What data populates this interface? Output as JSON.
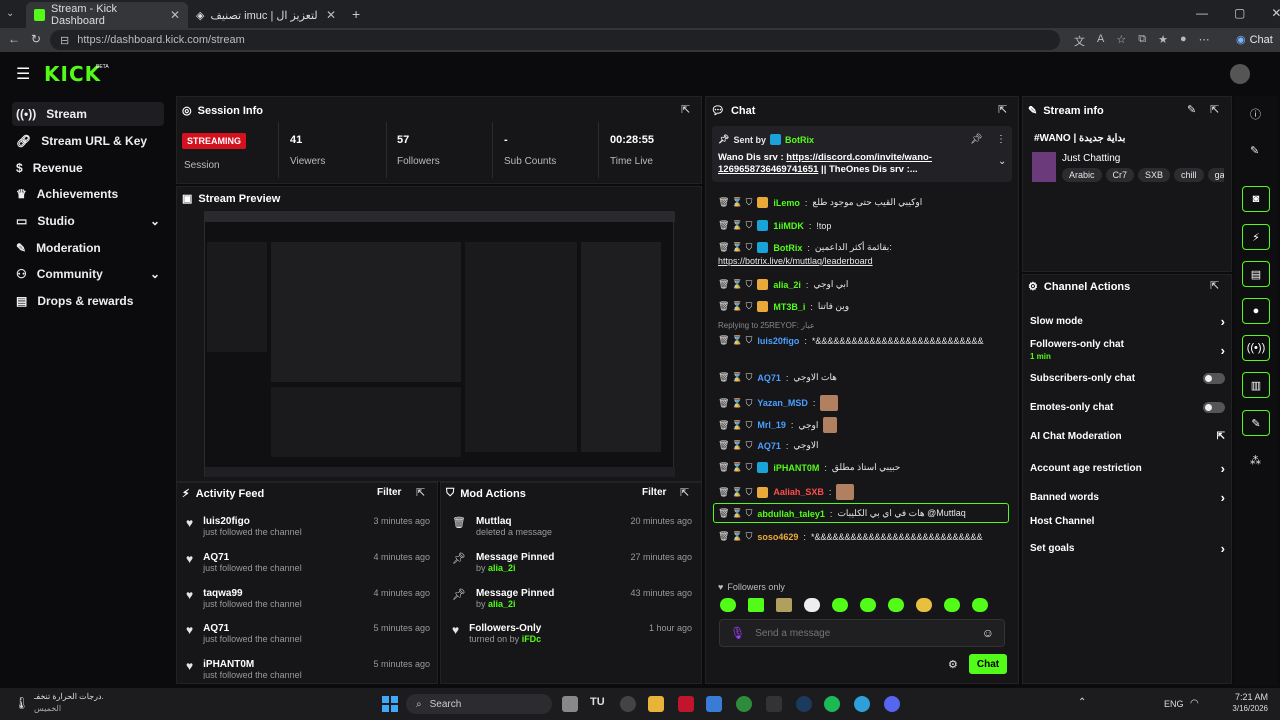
{
  "browser": {
    "tabs": [
      {
        "label": "Stream - Kick Dashboard"
      },
      {
        "label": "تصنيف imuc | أفضل برنامج لتعزيز ال..."
      }
    ],
    "url": "https://dashboard.kick.com/stream",
    "chat_label": "Chat"
  },
  "brand": {
    "logo": "KICK",
    "beta": "BETA"
  },
  "sidebar": {
    "items": [
      {
        "label": "Stream"
      },
      {
        "label": "Stream URL & Key"
      },
      {
        "label": "Revenue"
      },
      {
        "label": "Achievements"
      },
      {
        "label": "Studio"
      },
      {
        "label": "Moderation"
      },
      {
        "label": "Community"
      },
      {
        "label": "Drops & rewards"
      }
    ]
  },
  "session": {
    "title": "Session Info",
    "status": "STREAMING",
    "session_label": "Session",
    "stats": [
      {
        "value": "41",
        "label": "Viewers"
      },
      {
        "value": "57",
        "label": "Followers"
      },
      {
        "value": "-",
        "label": "Sub Counts"
      },
      {
        "value": "00:28:55",
        "label": "Time Live"
      }
    ]
  },
  "preview": {
    "title": "Stream Preview"
  },
  "activity": {
    "title": "Activity Feed",
    "filter": "Filter",
    "items": [
      {
        "name": "luis20figo",
        "desc": "just followed the channel",
        "time": "3 minutes ago"
      },
      {
        "name": "AQ71",
        "desc": "just followed the channel",
        "time": "4 minutes ago"
      },
      {
        "name": "taqwa99",
        "desc": "just followed the channel",
        "time": "4 minutes ago"
      },
      {
        "name": "AQ71",
        "desc": "just followed the channel",
        "time": "5 minutes ago"
      },
      {
        "name": "iPHANT0M",
        "desc": "just followed the channel",
        "time": "5 minutes ago"
      }
    ]
  },
  "modactions": {
    "title": "Mod Actions",
    "filter": "Filter",
    "items": [
      {
        "name": "Muttlaq",
        "desc": "deleted a message",
        "by": "",
        "time": "20 minutes ago"
      },
      {
        "name": "Message Pinned",
        "desc": "by",
        "by": "alia_2i",
        "time": "27 minutes ago"
      },
      {
        "name": "Message Pinned",
        "desc": "by",
        "by": "alia_2i",
        "time": "43 minutes ago"
      },
      {
        "name": "Followers-Only",
        "desc": "turned on by",
        "by": "iFDc",
        "time": "1 hour ago"
      }
    ]
  },
  "chat": {
    "title": "Chat",
    "pinned": {
      "sent_by": "Sent by",
      "user": "BotRix",
      "text_prefix": "Wano Dis srv : ",
      "link": "https://discord.com/invite/wano-1269658736469741651",
      "text_suffix": " || TheOnes Dis srv :..."
    },
    "messages": [
      {
        "user": "iLemo",
        "color": "#53fc18",
        "text": "اوكيبي القيب حتى موجود طلع"
      },
      {
        "user": "1iiMDK",
        "color": "#53fc18",
        "text": "!top"
      },
      {
        "user": "BotRix",
        "color": "#53fc18",
        "text": "بقائمة أكثر الداعمين:"
      },
      {
        "user": "alia_2i",
        "color": "#53fc18",
        "text": "ابي اوجي"
      },
      {
        "user": "MT3B_i",
        "color": "#53fc18",
        "text": "وين فاتنا"
      },
      {
        "user": "luis20figo",
        "color": "#4a9fff",
        "text": "*&&&&&&&&&&&&&&&&&&&&&&&&&&&&"
      },
      {
        "user": "AQ71",
        "color": "#4a9fff",
        "text": "هات الاوجي"
      },
      {
        "user": "Yazan_MSD",
        "color": "#4a9fff",
        "text": ""
      },
      {
        "user": "Mrl_19",
        "color": "#4a9fff",
        "text": "اوجي"
      },
      {
        "user": "AQ71",
        "color": "#4a9fff",
        "text": "الاوجي"
      },
      {
        "user": "iPHANT0M",
        "color": "#53fc18",
        "text": "حبيبي استاذ مطلق"
      },
      {
        "user": "Aaliah_SXB",
        "color": "#ff4d4d",
        "text": ""
      },
      {
        "user": "abdullah_taley1",
        "color": "#53fc18",
        "text": "هات في اي بي الكليبات @Muttlaq"
      },
      {
        "user": "soso4629",
        "color": "#e8a93a",
        "text": "*&&&&&&&&&&&&&&&&&&&&&&&&&&&&"
      }
    ],
    "botrix_link": "https://botrix.live/k/muttlaq/leaderboard",
    "reply": "Replying to 25REYOF: عبار",
    "followers_only": "Followers only",
    "placeholder": "Send a message",
    "send": "Chat"
  },
  "streaminfo": {
    "title": "Stream info",
    "stream_title": "#WANO | بداية جديدة",
    "category": "Just Chatting",
    "tags": [
      "Arabic",
      "Cr7",
      "SXB",
      "chill",
      "ga"
    ]
  },
  "channelactions": {
    "title": "Channel Actions",
    "items": [
      {
        "label": "Slow mode",
        "sub": "",
        "control": "chevron"
      },
      {
        "label": "Followers-only chat",
        "sub": "1 min",
        "control": "chevron"
      },
      {
        "label": "Subscribers-only chat",
        "sub": "",
        "control": "toggle"
      },
      {
        "label": "Emotes-only chat",
        "sub": "",
        "control": "toggle"
      },
      {
        "label": "AI Chat Moderation",
        "sub": "",
        "control": "external"
      },
      {
        "label": "Account age restriction",
        "sub": "",
        "control": "chevron"
      },
      {
        "label": "Banned words",
        "sub": "",
        "control": "chevron"
      },
      {
        "label": "Host Channel",
        "sub": "",
        "control": "none"
      },
      {
        "label": "Set goals",
        "sub": "",
        "control": "chevron"
      }
    ]
  },
  "taskbar": {
    "weather_line1": "درجات الحرارة تنخفـ...",
    "weather_line2": "الخميس",
    "search": "Search",
    "lang": "ENG",
    "time": "7:21 AM",
    "date": "3/16/2026"
  },
  "colors": {
    "accent": "#53fc18",
    "streaming": "#d4111e"
  }
}
